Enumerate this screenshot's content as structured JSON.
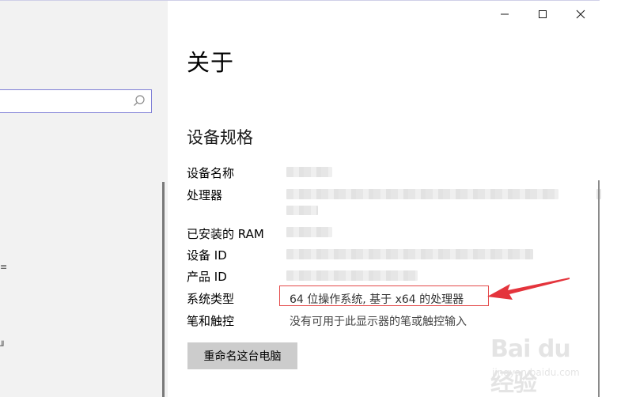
{
  "window": {
    "minimize_icon": "minimize-icon",
    "maximize_icon": "maximize-icon",
    "close_icon": "close-icon"
  },
  "sidebar": {
    "search_icon": "search-icon",
    "glyph_1": "≡",
    "glyph_2": "╜"
  },
  "page": {
    "title": "关于"
  },
  "specs": {
    "section_title": "设备规格",
    "rows": [
      {
        "label": "设备名称",
        "value": ""
      },
      {
        "label": "处理器",
        "value": ""
      },
      {
        "label": "已安装的 RAM",
        "value": ""
      },
      {
        "label": "设备 ID",
        "value": ""
      },
      {
        "label": "产品 ID",
        "value": ""
      },
      {
        "label": "系统类型",
        "value": "64 位操作系统, 基于 x64 的处理器"
      },
      {
        "label": "笔和触控",
        "value": "没有可用于此显示器的笔或触控输入"
      }
    ]
  },
  "actions": {
    "rename_label": "重命名这台电脑"
  },
  "annotation": {
    "highlight_color": "#e44b4b",
    "arrow_color": "#e4343c"
  },
  "watermark": {
    "brand": "Bai du 经验",
    "url": "jingyan.baidu.com"
  }
}
